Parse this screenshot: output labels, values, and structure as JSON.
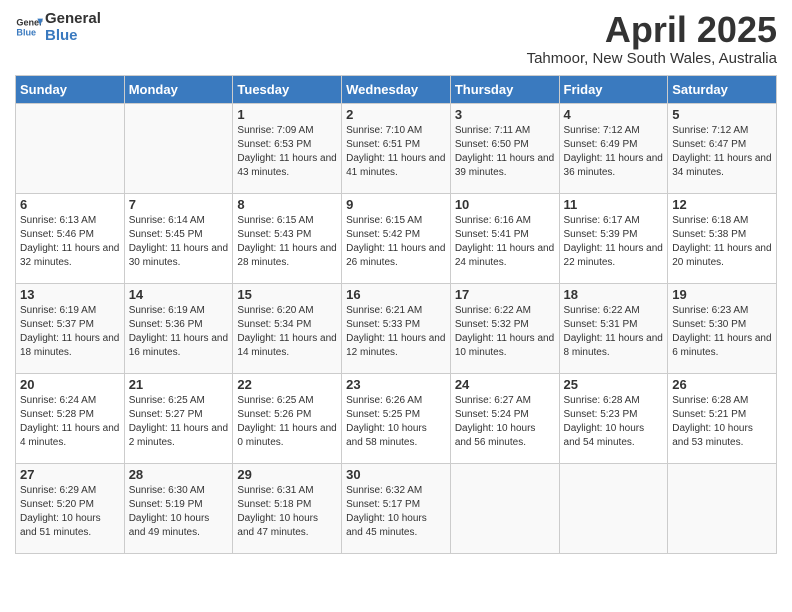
{
  "header": {
    "logo_line1": "General",
    "logo_line2": "Blue",
    "month_year": "April 2025",
    "location": "Tahmoor, New South Wales, Australia"
  },
  "days_of_week": [
    "Sunday",
    "Monday",
    "Tuesday",
    "Wednesday",
    "Thursday",
    "Friday",
    "Saturday"
  ],
  "weeks": [
    [
      {
        "num": "",
        "info": ""
      },
      {
        "num": "",
        "info": ""
      },
      {
        "num": "1",
        "info": "Sunrise: 7:09 AM\nSunset: 6:53 PM\nDaylight: 11 hours and 43 minutes."
      },
      {
        "num": "2",
        "info": "Sunrise: 7:10 AM\nSunset: 6:51 PM\nDaylight: 11 hours and 41 minutes."
      },
      {
        "num": "3",
        "info": "Sunrise: 7:11 AM\nSunset: 6:50 PM\nDaylight: 11 hours and 39 minutes."
      },
      {
        "num": "4",
        "info": "Sunrise: 7:12 AM\nSunset: 6:49 PM\nDaylight: 11 hours and 36 minutes."
      },
      {
        "num": "5",
        "info": "Sunrise: 7:12 AM\nSunset: 6:47 PM\nDaylight: 11 hours and 34 minutes."
      }
    ],
    [
      {
        "num": "6",
        "info": "Sunrise: 6:13 AM\nSunset: 5:46 PM\nDaylight: 11 hours and 32 minutes."
      },
      {
        "num": "7",
        "info": "Sunrise: 6:14 AM\nSunset: 5:45 PM\nDaylight: 11 hours and 30 minutes."
      },
      {
        "num": "8",
        "info": "Sunrise: 6:15 AM\nSunset: 5:43 PM\nDaylight: 11 hours and 28 minutes."
      },
      {
        "num": "9",
        "info": "Sunrise: 6:15 AM\nSunset: 5:42 PM\nDaylight: 11 hours and 26 minutes."
      },
      {
        "num": "10",
        "info": "Sunrise: 6:16 AM\nSunset: 5:41 PM\nDaylight: 11 hours and 24 minutes."
      },
      {
        "num": "11",
        "info": "Sunrise: 6:17 AM\nSunset: 5:39 PM\nDaylight: 11 hours and 22 minutes."
      },
      {
        "num": "12",
        "info": "Sunrise: 6:18 AM\nSunset: 5:38 PM\nDaylight: 11 hours and 20 minutes."
      }
    ],
    [
      {
        "num": "13",
        "info": "Sunrise: 6:19 AM\nSunset: 5:37 PM\nDaylight: 11 hours and 18 minutes."
      },
      {
        "num": "14",
        "info": "Sunrise: 6:19 AM\nSunset: 5:36 PM\nDaylight: 11 hours and 16 minutes."
      },
      {
        "num": "15",
        "info": "Sunrise: 6:20 AM\nSunset: 5:34 PM\nDaylight: 11 hours and 14 minutes."
      },
      {
        "num": "16",
        "info": "Sunrise: 6:21 AM\nSunset: 5:33 PM\nDaylight: 11 hours and 12 minutes."
      },
      {
        "num": "17",
        "info": "Sunrise: 6:22 AM\nSunset: 5:32 PM\nDaylight: 11 hours and 10 minutes."
      },
      {
        "num": "18",
        "info": "Sunrise: 6:22 AM\nSunset: 5:31 PM\nDaylight: 11 hours and 8 minutes."
      },
      {
        "num": "19",
        "info": "Sunrise: 6:23 AM\nSunset: 5:30 PM\nDaylight: 11 hours and 6 minutes."
      }
    ],
    [
      {
        "num": "20",
        "info": "Sunrise: 6:24 AM\nSunset: 5:28 PM\nDaylight: 11 hours and 4 minutes."
      },
      {
        "num": "21",
        "info": "Sunrise: 6:25 AM\nSunset: 5:27 PM\nDaylight: 11 hours and 2 minutes."
      },
      {
        "num": "22",
        "info": "Sunrise: 6:25 AM\nSunset: 5:26 PM\nDaylight: 11 hours and 0 minutes."
      },
      {
        "num": "23",
        "info": "Sunrise: 6:26 AM\nSunset: 5:25 PM\nDaylight: 10 hours and 58 minutes."
      },
      {
        "num": "24",
        "info": "Sunrise: 6:27 AM\nSunset: 5:24 PM\nDaylight: 10 hours and 56 minutes."
      },
      {
        "num": "25",
        "info": "Sunrise: 6:28 AM\nSunset: 5:23 PM\nDaylight: 10 hours and 54 minutes."
      },
      {
        "num": "26",
        "info": "Sunrise: 6:28 AM\nSunset: 5:21 PM\nDaylight: 10 hours and 53 minutes."
      }
    ],
    [
      {
        "num": "27",
        "info": "Sunrise: 6:29 AM\nSunset: 5:20 PM\nDaylight: 10 hours and 51 minutes."
      },
      {
        "num": "28",
        "info": "Sunrise: 6:30 AM\nSunset: 5:19 PM\nDaylight: 10 hours and 49 minutes."
      },
      {
        "num": "29",
        "info": "Sunrise: 6:31 AM\nSunset: 5:18 PM\nDaylight: 10 hours and 47 minutes."
      },
      {
        "num": "30",
        "info": "Sunrise: 6:32 AM\nSunset: 5:17 PM\nDaylight: 10 hours and 45 minutes."
      },
      {
        "num": "",
        "info": ""
      },
      {
        "num": "",
        "info": ""
      },
      {
        "num": "",
        "info": ""
      }
    ]
  ]
}
